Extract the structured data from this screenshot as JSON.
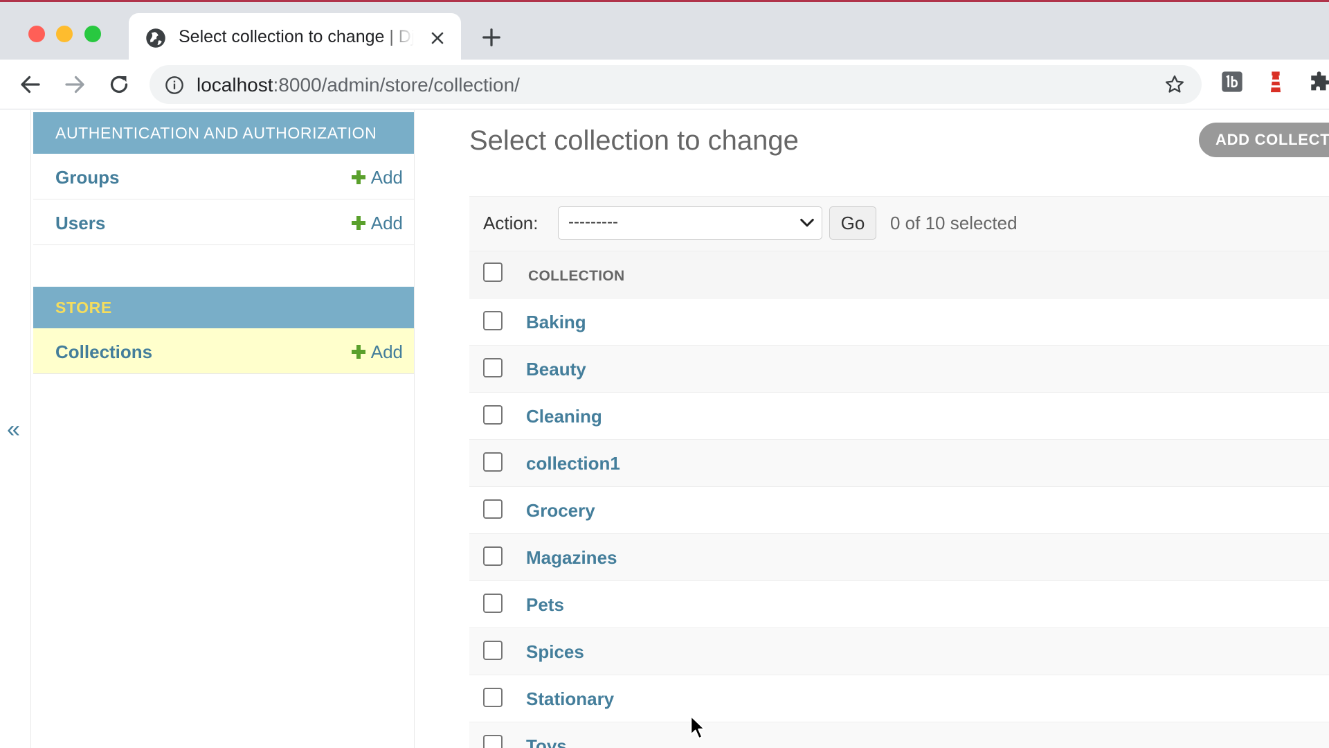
{
  "browser": {
    "tab_title": "Select collection to change | Django site admin",
    "url_host": "localhost",
    "url_path": ":8000/admin/store/collection/"
  },
  "sidebar": {
    "toggle_glyph": "«",
    "modules": [
      {
        "caption": "AUTHENTICATION AND AUTHORIZATION",
        "models": [
          {
            "name": "Groups",
            "add_label": "Add"
          },
          {
            "name": "Users",
            "add_label": "Add"
          }
        ]
      },
      {
        "caption": "STORE",
        "models": [
          {
            "name": "Collections",
            "add_label": "Add",
            "current": true
          }
        ]
      }
    ]
  },
  "main": {
    "title": "Select collection to change",
    "add_button": "ADD COLLECTION",
    "actions": {
      "label": "Action:",
      "selected_option": "---------",
      "go_label": "Go",
      "selected_count": "0 of 10 selected"
    },
    "table": {
      "column_header": "COLLECTION",
      "rows": [
        "Baking",
        "Beauty",
        "Cleaning",
        "collection1",
        "Grocery",
        "Magazines",
        "Pets",
        "Spices",
        "Stationary",
        "Toys"
      ]
    }
  },
  "colors": {
    "module_caption_bg": "#79aec8",
    "link": "#447e9b",
    "add_plus": "#5aa02c",
    "current_row": "#ffffcc",
    "store_caption_text": "#f5dd5d"
  }
}
